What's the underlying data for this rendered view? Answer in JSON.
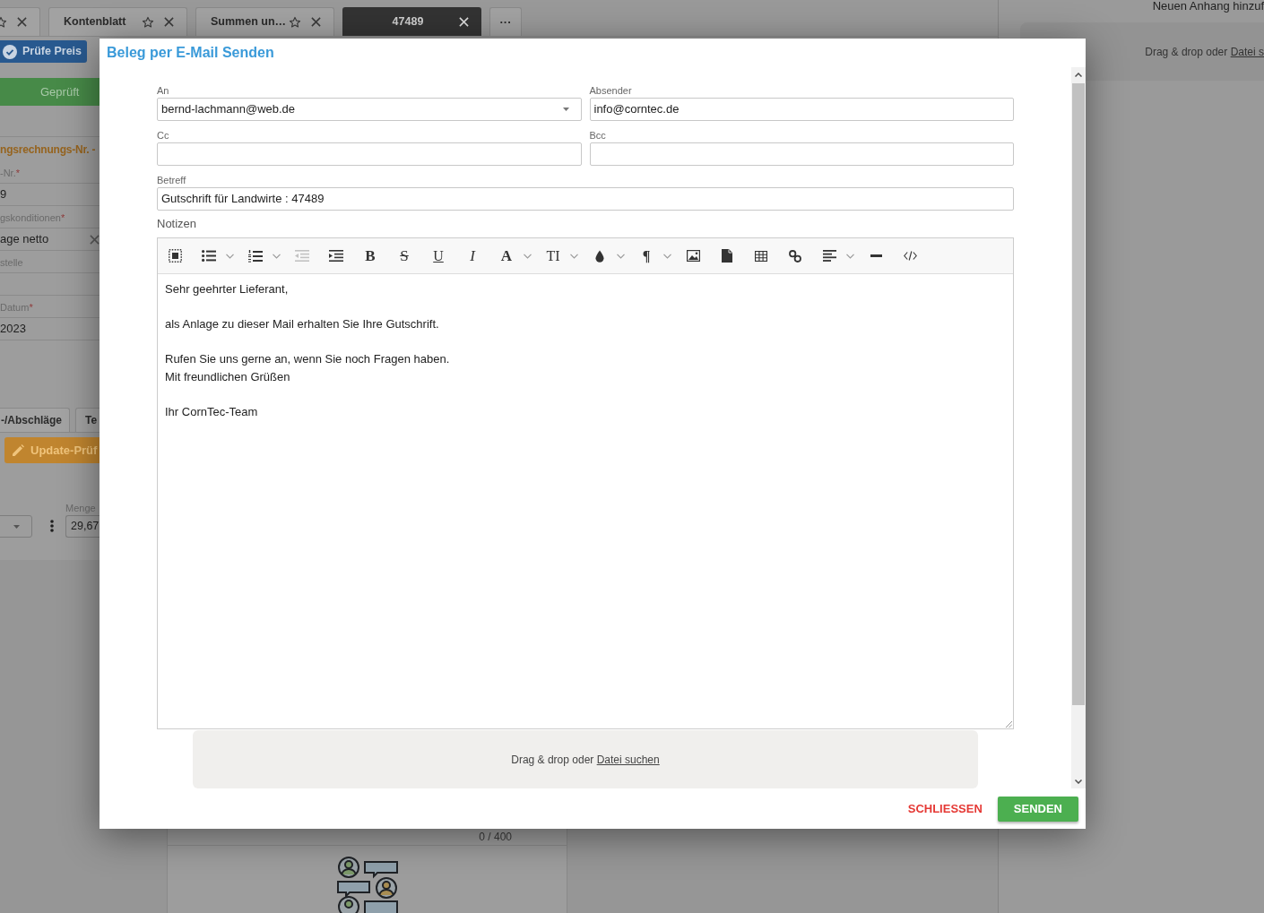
{
  "background": {
    "tabs": [
      {
        "selected": false
      },
      {
        "label": "Kontenblatt",
        "selected": false
      },
      {
        "label": "Summen un…",
        "selected": false
      },
      {
        "label": "47489",
        "selected": true
      }
    ],
    "more_tabs_button": "···",
    "check_price_button": "Prüfe Preis",
    "status_bar": "Geprüft",
    "section_title": "ngsrechnungs-Nr. -",
    "form_rows": [
      {
        "label": "-Nr.",
        "required_mark": "*",
        "value": "9",
        "clearable": false
      },
      {
        "label": "gskonditionen",
        "required_mark": "*",
        "value": "age netto",
        "clearable": true
      },
      {
        "label": "stelle",
        "clearable": false
      },
      {
        "label": "Datum",
        "required_mark": "*",
        "value": "2023",
        "clearable": false
      }
    ],
    "sub_tabs": [
      {
        "label": "-/Abschläge",
        "selected": false
      },
      {
        "label": "Te",
        "selected": false
      }
    ],
    "update_button": "Update-Prüf",
    "quantity": {
      "label": "Menge",
      "value": "29,67"
    },
    "counter": "0 / 400",
    "attachments": {
      "title": "Neuen Anhang hinzuf",
      "drop_text": "Drag & drop oder",
      "drop_link": "Datei s"
    }
  },
  "dialog": {
    "title": "Beleg per E-Mail Senden",
    "field_rows": [
      [
        {
          "label": "An",
          "kind": "select",
          "value": "bernd-lachmann@web.de"
        },
        {
          "label": "Absender",
          "kind": "text",
          "value": "info@corntec.de"
        }
      ],
      [
        {
          "label": "Cc",
          "kind": "text"
        },
        {
          "label": "Bcc",
          "kind": "text"
        }
      ],
      [
        {
          "label": "Betreff",
          "kind": "text",
          "value": "Gutschrift für Landwirte : 47489"
        }
      ]
    ],
    "notes": {
      "label": "Notizen",
      "toolbar": [
        {
          "kind": "select_all",
          "dropdown": false,
          "disabled": false
        },
        {
          "kind": "bullet_list",
          "dropdown": true,
          "disabled": false
        },
        {
          "kind": "numbered_list",
          "dropdown": true,
          "disabled": false
        },
        {
          "kind": "outdent",
          "dropdown": false,
          "disabled": true
        },
        {
          "kind": "indent",
          "dropdown": false,
          "disabled": false
        },
        {
          "kind": "bold",
          "text": "B",
          "dropdown": false,
          "disabled": false
        },
        {
          "kind": "strikethrough",
          "text": "S",
          "dropdown": false,
          "disabled": false
        },
        {
          "kind": "underline",
          "text": "U",
          "dropdown": false,
          "disabled": false
        },
        {
          "kind": "italic",
          "text": "I",
          "dropdown": false,
          "disabled": false
        },
        {
          "kind": "font",
          "text": "A",
          "dropdown": true,
          "disabled": false
        },
        {
          "kind": "font_size",
          "text": "TI",
          "dropdown": true,
          "disabled": false
        },
        {
          "kind": "color",
          "dropdown": true,
          "disabled": false
        },
        {
          "kind": "paragraph",
          "text": "¶",
          "dropdown": true,
          "disabled": false
        },
        {
          "kind": "image",
          "dropdown": false,
          "disabled": false
        },
        {
          "kind": "file",
          "dropdown": false,
          "disabled": false
        },
        {
          "kind": "table",
          "dropdown": false,
          "disabled": false
        },
        {
          "kind": "link",
          "dropdown": false,
          "disabled": false
        },
        {
          "kind": "align",
          "dropdown": true,
          "disabled": false
        },
        {
          "kind": "horizontal_rule",
          "dropdown": false,
          "disabled": false
        },
        {
          "kind": "code_view",
          "dropdown": false,
          "disabled": false
        }
      ],
      "blocks": [
        {
          "lines": [
            "Sehr geehrter Lieferant,"
          ]
        },
        {
          "lines": [
            "als Anlage zu dieser Mail erhalten Sie Ihre Gutschrift."
          ]
        },
        {
          "lines": [
            "Rufen Sie uns gerne an, wenn Sie noch Fragen haben.",
            "Mit freundlichen Grüßen"
          ]
        },
        {
          "lines": [
            "Ihr CornTec-Team"
          ]
        }
      ]
    },
    "dropzone": {
      "text": "Drag & drop oder",
      "link": "Datei suchen"
    },
    "buttons": [
      {
        "label": "SCHLIESSEN",
        "kind": "text"
      },
      {
        "label": "SENDEN",
        "kind": "primary"
      }
    ]
  }
}
